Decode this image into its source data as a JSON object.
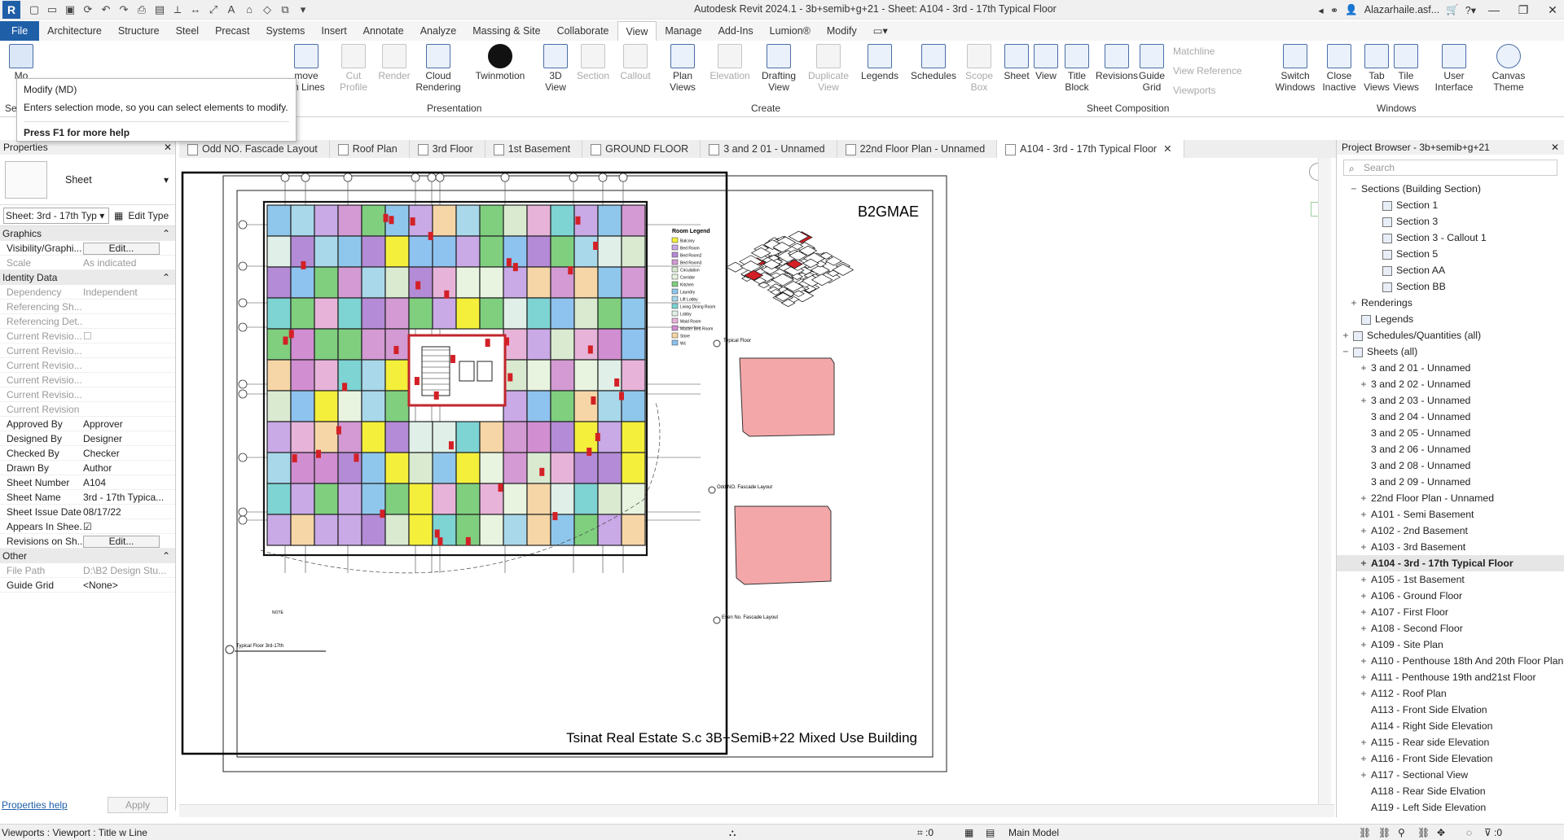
{
  "app": {
    "title": "Autodesk Revit 2024.1 - 3b+semib+g+21 - Sheet: A104 - 3rd - 17th Typical Floor",
    "user": "Alazarhaile.asf...",
    "logo": "R"
  },
  "ribbon": {
    "tabs": [
      "File",
      "Architecture",
      "Structure",
      "Steel",
      "Precast",
      "Systems",
      "Insert",
      "Annotate",
      "Analyze",
      "Massing & Site",
      "Collaborate",
      "View",
      "Manage",
      "Add-Ins",
      "Lumion®",
      "Modify"
    ],
    "active_tab": "View",
    "buttons": [
      {
        "id": "modify",
        "label": "Mo",
        "sub": ""
      },
      {
        "id": "remove_hidden",
        "label": "move",
        "sub": "en Lines"
      },
      {
        "id": "cut_profile",
        "label": "Cut",
        "sub": "Profile"
      },
      {
        "id": "render",
        "label": "Render",
        "sub": ""
      },
      {
        "id": "cloud",
        "label": "Cloud",
        "sub": "Rendering"
      },
      {
        "id": "twin",
        "label": "Twinmotion",
        "sub": ""
      },
      {
        "id": "3d",
        "label": "3D",
        "sub": "View"
      },
      {
        "id": "section",
        "label": "Section",
        "sub": ""
      },
      {
        "id": "callout",
        "label": "Callout",
        "sub": ""
      },
      {
        "id": "plan",
        "label": "Plan",
        "sub": "Views"
      },
      {
        "id": "elevation",
        "label": "Elevation",
        "sub": ""
      },
      {
        "id": "drafting",
        "label": "Drafting",
        "sub": "View"
      },
      {
        "id": "duplicate",
        "label": "Duplicate",
        "sub": "View"
      },
      {
        "id": "legends",
        "label": "Legends",
        "sub": ""
      },
      {
        "id": "schedules",
        "label": "Schedules",
        "sub": ""
      },
      {
        "id": "scope",
        "label": "Scope",
        "sub": "Box"
      },
      {
        "id": "sheet",
        "label": "Sheet",
        "sub": ""
      },
      {
        "id": "view",
        "label": "View",
        "sub": ""
      },
      {
        "id": "title_block",
        "label": "Title",
        "sub": "Block"
      },
      {
        "id": "revisions",
        "label": "Revisions",
        "sub": ""
      },
      {
        "id": "guide",
        "label": "Guide",
        "sub": "Grid"
      },
      {
        "id": "switch",
        "label": "Switch",
        "sub": "Windows"
      },
      {
        "id": "close_inactive",
        "label": "Close",
        "sub": "Inactive"
      },
      {
        "id": "tab_views",
        "label": "Tab",
        "sub": "Views"
      },
      {
        "id": "tile_views",
        "label": "Tile",
        "sub": "Views"
      },
      {
        "id": "user_interface",
        "label": "User",
        "sub": "Interface"
      },
      {
        "id": "canvas_theme",
        "label": "Canvas",
        "sub": "Theme"
      }
    ],
    "small": [
      "Matchline",
      "View Reference",
      "Viewports"
    ],
    "panels": [
      "Sele",
      "Presentation",
      "Create",
      "Sheet Composition",
      "Windows"
    ]
  },
  "tooltip": {
    "title": "Modify (MD)",
    "desc": "Enters selection mode, so you can select elements to modify.",
    "help": "Press F1 for more help"
  },
  "doc_tabs": [
    "Odd NO. Fascade Layout",
    "Roof Plan",
    "3rd Floor",
    "1st Basement",
    "GROUND FLOOR",
    "3 and  2 01 - Unnamed",
    "22nd Floor Plan - Unnamed",
    "A104 - 3rd - 17th Typical Floor"
  ],
  "properties": {
    "header": "Properties",
    "type": "Sheet",
    "instance": "Sheet: 3rd - 17th Typ",
    "edit_type": "Edit Type",
    "categories": {
      "graphics": "Graphics",
      "identity": "Identity Data",
      "other": "Other"
    },
    "graphics": [
      {
        "n": "Visibility/Graphi...",
        "v": "Edit...",
        "btn": true
      },
      {
        "n": "Scale",
        "v": "As indicated",
        "gray": true
      }
    ],
    "identity": [
      {
        "n": "Dependency",
        "v": "Independent",
        "gray": true
      },
      {
        "n": "Referencing Sh...",
        "v": "",
        "gray": true
      },
      {
        "n": "Referencing Det...",
        "v": "",
        "gray": true
      },
      {
        "n": "Current Revisio...",
        "v": "☐",
        "gray": true
      },
      {
        "n": "Current Revisio...",
        "v": "",
        "gray": true
      },
      {
        "n": "Current Revisio...",
        "v": "",
        "gray": true
      },
      {
        "n": "Current Revisio...",
        "v": "",
        "gray": true
      },
      {
        "n": "Current Revisio...",
        "v": "",
        "gray": true
      },
      {
        "n": "Current Revision",
        "v": "",
        "gray": true
      },
      {
        "n": "Approved By",
        "v": "Approver"
      },
      {
        "n": "Designed By",
        "v": "Designer"
      },
      {
        "n": "Checked By",
        "v": "Checker"
      },
      {
        "n": "Drawn By",
        "v": "Author"
      },
      {
        "n": "Sheet Number",
        "v": "A104"
      },
      {
        "n": "Sheet Name",
        "v": "3rd - 17th Typica..."
      },
      {
        "n": "Sheet Issue Date",
        "v": "08/17/22"
      },
      {
        "n": "Appears In Shee...",
        "v": "☑"
      },
      {
        "n": "Revisions on Sh...",
        "v": "Edit...",
        "btn": true
      }
    ],
    "other": [
      {
        "n": "File Path",
        "v": "D:\\B2 Design Stu...",
        "gray": true
      },
      {
        "n": "Guide Grid",
        "v": "<None>"
      }
    ],
    "help": "Properties help",
    "apply": "Apply"
  },
  "sheet": {
    "company": "B2GMAE",
    "project_title": "Tsinat Real Estate S.c 3B+SemiB+22 Mixed Use Building",
    "view_title": "Typical Floor 3rd-17th",
    "legend_title": "Room Legend",
    "legend_items": [
      "Balcony",
      "Bed Room",
      "Bed Room2",
      "Bed Room3",
      "Circulation",
      "Corridor",
      "Kitchen",
      "Laundry",
      "Lift Lobby",
      "Living Dining Room",
      "Lobby",
      "Maid Room",
      "Master Bed Room",
      "Store",
      "Wc"
    ],
    "legend_colors": [
      "#f4ef3a",
      "#c9a9e6",
      "#b48bd6",
      "#d39ad3",
      "#d9ead1",
      "#e8f4e0",
      "#7fcf7f",
      "#8fc7ec",
      "#a8d8ea",
      "#7ed3d3",
      "#e0f0e8",
      "#e7b3d9",
      "#d18ed1",
      "#f6d6a6",
      "#8ec2ef"
    ],
    "callouts": [
      "Typical Floor",
      "Odd NO. Fascade Layout",
      "Even No. Fascade Layout"
    ],
    "note": "NOTE"
  },
  "project_browser": {
    "header": "Project Browser - 3b+semib+g+21",
    "search": "Search",
    "items": [
      {
        "t": "Sections (Building Section)",
        "lvl": 1,
        "exp": "−"
      },
      {
        "t": "Section 1",
        "lvl": 3,
        "icon": true
      },
      {
        "t": "Section 3",
        "lvl": 3,
        "icon": true
      },
      {
        "t": "Section 3 - Callout 1",
        "lvl": 3,
        "icon": true
      },
      {
        "t": "Section 5",
        "lvl": 3,
        "icon": true
      },
      {
        "t": "Section AA",
        "lvl": 3,
        "icon": true
      },
      {
        "t": "Section BB",
        "lvl": 3,
        "icon": true
      },
      {
        "t": "Renderings",
        "lvl": 1,
        "exp": "+"
      },
      {
        "t": "Legends",
        "lvl": 1,
        "icon": true
      },
      {
        "t": "Schedules/Quantities (all)",
        "lvl": 0,
        "exp": "+",
        "icon": true
      },
      {
        "t": "Sheets (all)",
        "lvl": 0,
        "exp": "−",
        "icon": true
      },
      {
        "t": "3 and 2 01 - Unnamed",
        "lvl": 2,
        "exp": "+"
      },
      {
        "t": "3 and 2 02 - Unnamed",
        "lvl": 2,
        "exp": "+"
      },
      {
        "t": "3 and 2 03 - Unnamed",
        "lvl": 2,
        "exp": "+"
      },
      {
        "t": "3 and 2 04 - Unnamed",
        "lvl": 2
      },
      {
        "t": "3 and 2 05 - Unnamed",
        "lvl": 2
      },
      {
        "t": "3 and 2 06 - Unnamed",
        "lvl": 2
      },
      {
        "t": "3 and 2 08 - Unnamed",
        "lvl": 2
      },
      {
        "t": "3 and 2 09 - Unnamed",
        "lvl": 2
      },
      {
        "t": "22nd Floor Plan - Unnamed",
        "lvl": 2,
        "exp": "+"
      },
      {
        "t": "A101 - Semi Basement",
        "lvl": 2,
        "exp": "+"
      },
      {
        "t": "A102 - 2nd Basement",
        "lvl": 2,
        "exp": "+"
      },
      {
        "t": "A103 - 3rd Basement",
        "lvl": 2,
        "exp": "+"
      },
      {
        "t": "A104 - 3rd - 17th Typical Floor",
        "lvl": 2,
        "exp": "+",
        "sel": true
      },
      {
        "t": "A105 - 1st Basement",
        "lvl": 2,
        "exp": "+"
      },
      {
        "t": "A106 - Ground Floor",
        "lvl": 2,
        "exp": "+"
      },
      {
        "t": "A107 - First Floor",
        "lvl": 2,
        "exp": "+"
      },
      {
        "t": "A108 - Second Floor",
        "lvl": 2,
        "exp": "+"
      },
      {
        "t": "A109 - Site Plan",
        "lvl": 2,
        "exp": "+"
      },
      {
        "t": "A110 - Penthouse 18th And 20th Floor Plan",
        "lvl": 2,
        "exp": "+"
      },
      {
        "t": "A111 - Penthouse 19th and21st Floor",
        "lvl": 2,
        "exp": "+"
      },
      {
        "t": "A112 - Roof Plan",
        "lvl": 2,
        "exp": "+"
      },
      {
        "t": "A113 - Front Side Elvation",
        "lvl": 2
      },
      {
        "t": "A114 - Right Side Elevation",
        "lvl": 2
      },
      {
        "t": "A115 - Rear side Elevation",
        "lvl": 2,
        "exp": "+"
      },
      {
        "t": "A116 - Front Side Elevation",
        "lvl": 2,
        "exp": "+"
      },
      {
        "t": "A117 - Sectional View",
        "lvl": 2,
        "exp": "+"
      },
      {
        "t": "A118 - Rear Side Elvation",
        "lvl": 2
      },
      {
        "t": "A119 - Left Side Elevation",
        "lvl": 2
      }
    ]
  },
  "status": {
    "left": "Viewports : Viewport : Title w Line",
    "model": "Main Model",
    "zero1": ":0",
    "zero2": ":0"
  }
}
